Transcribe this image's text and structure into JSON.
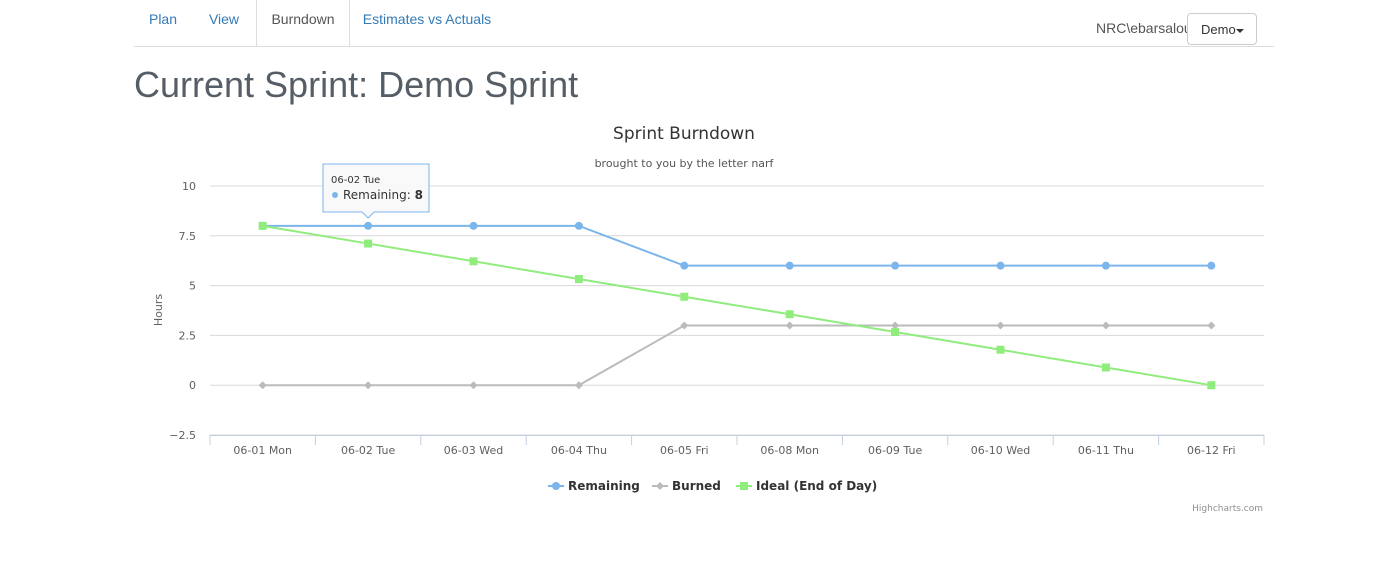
{
  "nav": {
    "tabs": [
      {
        "label": "Plan"
      },
      {
        "label": "View"
      },
      {
        "label": "Burndown"
      },
      {
        "label": "Estimates vs Actuals"
      }
    ],
    "active_tab": "Burndown",
    "user": "NRC\\ebarsalou",
    "project_select": "Demo"
  },
  "page": {
    "title": "Current Sprint: Demo Sprint"
  },
  "chart_data": {
    "type": "line",
    "title": "Sprint Burndown",
    "subtitle": "brought to you by the letter narf",
    "ylabel": "Hours",
    "xlabel": "",
    "ylim": [
      -2.5,
      10
    ],
    "yticks": [
      -2.5,
      0,
      2.5,
      5,
      7.5,
      10
    ],
    "ytick_labels": [
      "−2.5",
      "0",
      "2.5",
      "5",
      "7.5",
      "10"
    ],
    "categories": [
      "06-01 Mon",
      "06-02 Tue",
      "06-03 Wed",
      "06-04 Thu",
      "06-05 Fri",
      "06-08 Mon",
      "06-09 Tue",
      "06-10 Wed",
      "06-11 Thu",
      "06-12 Fri"
    ],
    "grid": true,
    "legend_position": "bottom-center",
    "series": [
      {
        "name": "Remaining",
        "color": "#7cb5ec",
        "marker": "circle",
        "values": [
          8,
          8,
          8,
          8,
          6,
          6,
          6,
          6,
          6,
          6
        ]
      },
      {
        "name": "Burned",
        "color": "#bbbbbb",
        "marker": "diamond",
        "values": [
          0,
          0,
          0,
          0,
          3,
          3,
          3,
          3,
          3,
          3
        ]
      },
      {
        "name": "Ideal (End of Day)",
        "color": "#90ed7d",
        "marker": "square",
        "values": [
          8,
          7.11,
          6.22,
          5.33,
          4.44,
          3.56,
          2.67,
          1.78,
          0.89,
          0
        ]
      }
    ],
    "tooltip": {
      "header": "06-02 Tue",
      "series_name": "Remaining",
      "label": "Remaining: ",
      "value": "8"
    },
    "credits": "Highcharts.com"
  }
}
